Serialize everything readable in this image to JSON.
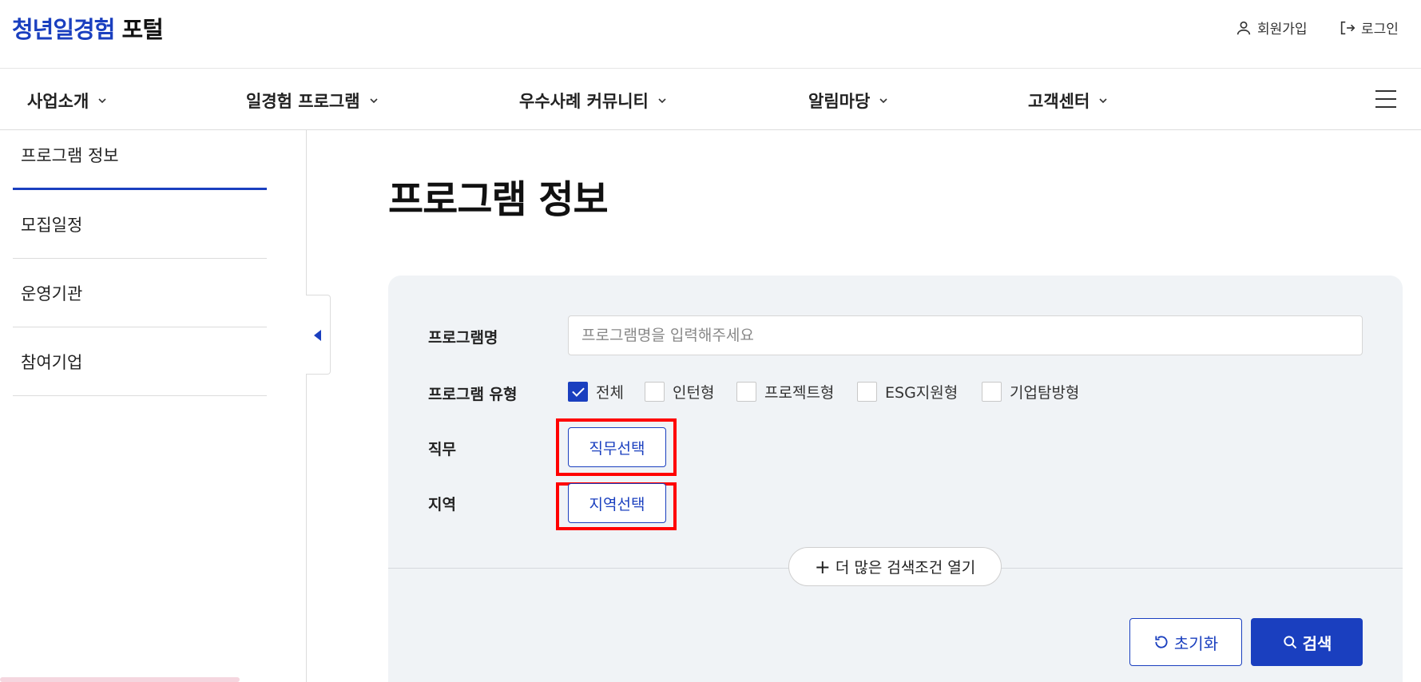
{
  "header": {
    "logo_part1": "청년일경험",
    "logo_part2": "포털",
    "signup_label": "회원가입",
    "login_label": "로그인"
  },
  "gnb": {
    "items": [
      {
        "label": "사업소개"
      },
      {
        "label": "일경험 프로그램"
      },
      {
        "label": "우수사례 커뮤니티"
      },
      {
        "label": "알림마당"
      },
      {
        "label": "고객센터"
      }
    ]
  },
  "sidebar": {
    "items": [
      {
        "label": "프로그램 정보",
        "active": true
      },
      {
        "label": "모집일정"
      },
      {
        "label": "운영기관"
      },
      {
        "label": "참여기업"
      }
    ]
  },
  "main": {
    "title": "프로그램 정보",
    "search": {
      "program_name_label": "프로그램명",
      "program_name_placeholder": "프로그램명을 입력해주세요",
      "program_type_label": "프로그램 유형",
      "program_types": [
        {
          "label": "전체",
          "checked": true
        },
        {
          "label": "인턴형",
          "checked": false
        },
        {
          "label": "프로젝트형",
          "checked": false
        },
        {
          "label": "ESG지원형",
          "checked": false
        },
        {
          "label": "기업탐방형",
          "checked": false
        }
      ],
      "job_label": "직무",
      "job_button": "직무선택",
      "region_label": "지역",
      "region_button": "지역선택",
      "more_conditions": "더 많은 검색조건 열기",
      "reset_label": "초기화",
      "search_label": "검색"
    }
  },
  "colors": {
    "brand_blue": "#1a3fbf",
    "highlight_red": "#ff0000",
    "panel_bg": "#f0f3f6"
  }
}
